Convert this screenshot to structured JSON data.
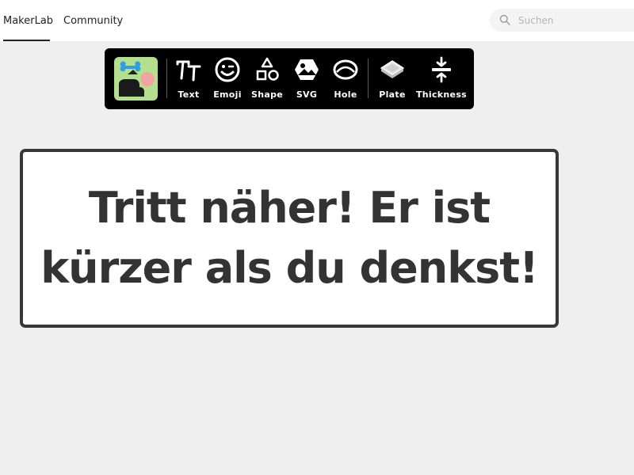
{
  "header": {
    "tabs": [
      {
        "label": "MakerLab",
        "active": true
      },
      {
        "label": "Community",
        "active": false
      }
    ],
    "search": {
      "placeholder": "Suchen",
      "value": ""
    }
  },
  "toolbar": {
    "tools": [
      {
        "label": "Text",
        "icon": "text-icon"
      },
      {
        "label": "Emoji",
        "icon": "emoji-icon"
      },
      {
        "label": "Shape",
        "icon": "shape-icon"
      },
      {
        "label": "SVG",
        "icon": "svg-image-icon"
      },
      {
        "label": "Hole",
        "icon": "hole-icon"
      },
      {
        "label": "Plate",
        "icon": "plate-icon"
      },
      {
        "label": "Thickness",
        "icon": "thickness-icon"
      }
    ]
  },
  "canvas": {
    "sign_text": "Tritt näher! Er ist kürzer als du denkst!"
  },
  "colors": {
    "toolbar_bg": "#000000",
    "logo_bg": "#b3df8f",
    "page_bg": "#efefef",
    "sign_border": "#383838",
    "sign_text": "#333333"
  }
}
